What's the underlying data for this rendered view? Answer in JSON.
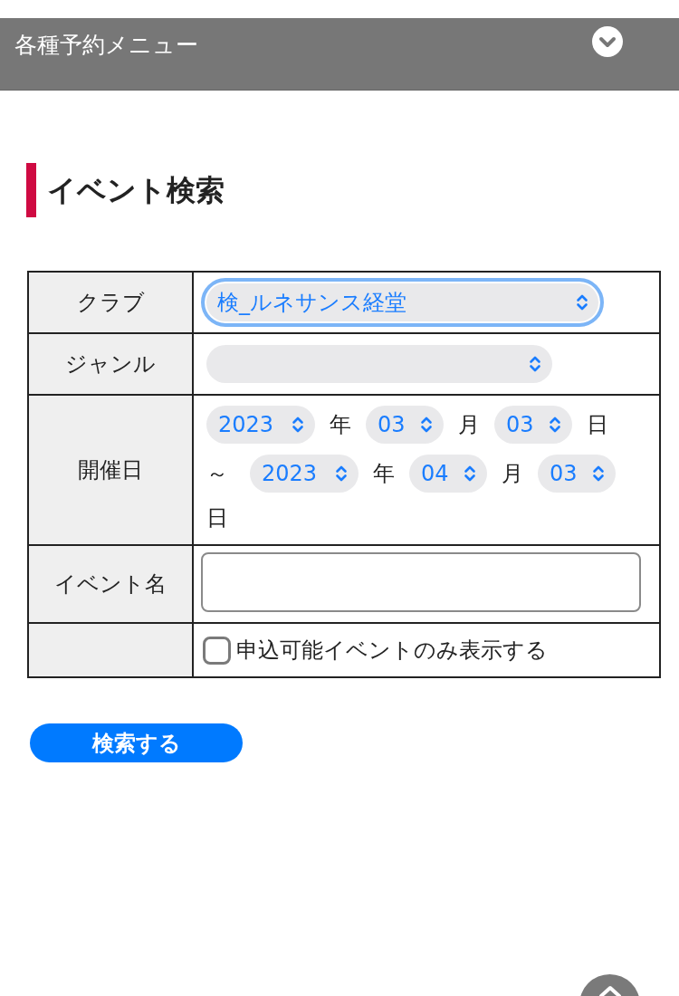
{
  "menu_bar": {
    "title": "各種予約メニュー",
    "expanded": false
  },
  "heading": "イベント検索",
  "form": {
    "rows": [
      {
        "kind": "select",
        "label": "クラブ",
        "value": "検_ルネサンス経堂",
        "focused": true
      },
      {
        "kind": "select",
        "label": "ジャンル",
        "focused": false
      },
      {
        "kind": "date_range",
        "label": "開催日",
        "from": [
          {
            "value": "2023",
            "unit": "年"
          },
          {
            "value": "03",
            "unit": "月"
          },
          {
            "value": "03",
            "unit": "日"
          }
        ],
        "separator": "～",
        "to": [
          {
            "value": "2023",
            "unit": "年"
          },
          {
            "value": "04",
            "unit": "月"
          },
          {
            "value": "03",
            "unit": "日"
          }
        ]
      },
      {
        "kind": "text",
        "label": "イベント名"
      },
      {
        "kind": "checkbox",
        "option": "申込可能イベントのみ表示する",
        "checked": false
      }
    ]
  },
  "search_button": "検索する"
}
